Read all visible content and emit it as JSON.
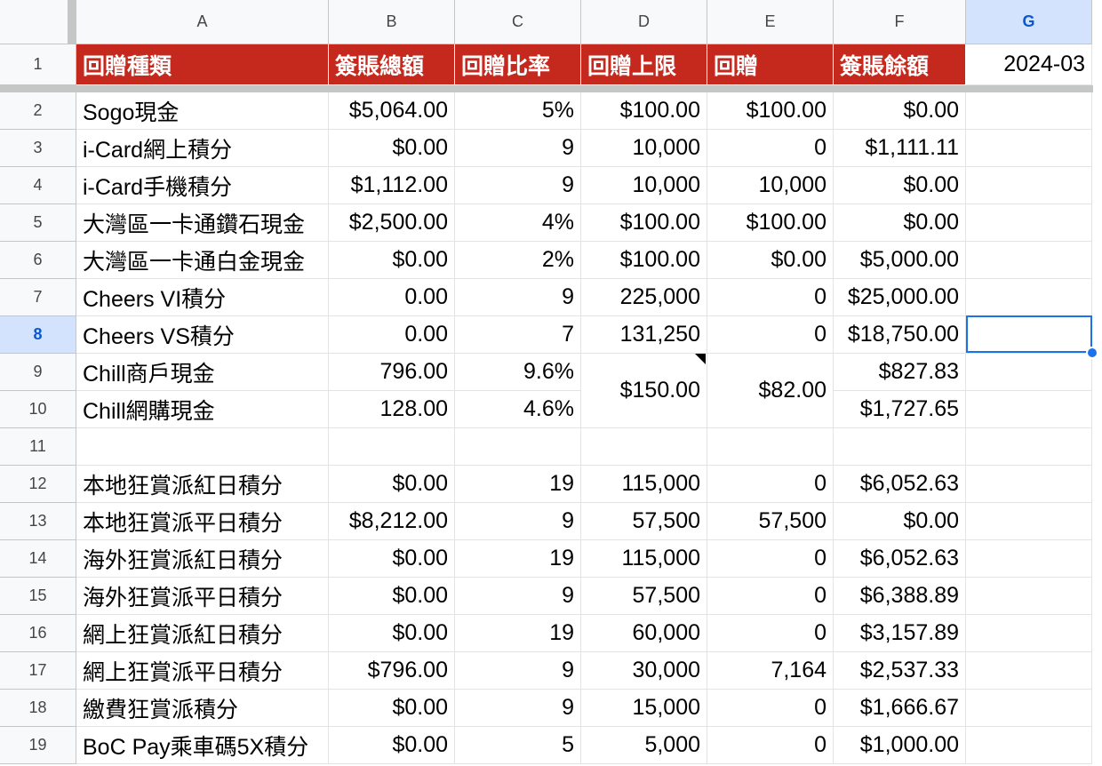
{
  "columns": [
    "A",
    "B",
    "C",
    "D",
    "E",
    "F",
    "G"
  ],
  "selected_column": "G",
  "selected_row": "8",
  "header_row": {
    "row": "1",
    "cells": [
      "回贈種類",
      "簽賬總額",
      "回贈比率",
      "回贈上限",
      "回贈",
      "簽賬餘額"
    ],
    "date": "2024-03"
  },
  "rows": [
    {
      "row": "2",
      "cells": [
        "Sogo現金",
        "$5,064.00",
        "5%",
        "$100.00",
        "$100.00",
        "$0.00",
        ""
      ]
    },
    {
      "row": "3",
      "cells": [
        "i-Card網上積分",
        "$0.00",
        "9",
        "10,000",
        "0",
        "$1,111.11",
        ""
      ]
    },
    {
      "row": "4",
      "cells": [
        "i-Card手機積分",
        "$1,112.00",
        "9",
        "10,000",
        "10,000",
        "$0.00",
        ""
      ]
    },
    {
      "row": "5",
      "cells": [
        "大灣區一卡通鑽石現金",
        "$2,500.00",
        "4%",
        "$100.00",
        "$100.00",
        "$0.00",
        ""
      ]
    },
    {
      "row": "6",
      "cells": [
        "大灣區一卡通白金現金",
        "$0.00",
        "2%",
        "$100.00",
        "$0.00",
        "$5,000.00",
        ""
      ]
    },
    {
      "row": "7",
      "cells": [
        "Cheers VI積分",
        "0.00",
        "9",
        "225,000",
        "0",
        "$25,000.00",
        ""
      ]
    },
    {
      "row": "8",
      "cells": [
        "Cheers VS積分",
        "0.00",
        "7",
        "131,250",
        "0",
        "$18,750.00",
        ""
      ]
    },
    {
      "row": "9",
      "cells": [
        "Chill商戶現金",
        "796.00",
        "9.6%",
        "",
        "",
        "$827.83",
        ""
      ]
    },
    {
      "row": "10",
      "cells": [
        "Chill網購現金",
        "128.00",
        "4.6%",
        "",
        "",
        "$1,727.65",
        ""
      ]
    },
    {
      "row": "11",
      "cells": [
        "",
        "",
        "",
        "",
        "",
        "",
        ""
      ]
    },
    {
      "row": "12",
      "cells": [
        "本地狂賞派紅日積分",
        "$0.00",
        "19",
        "115,000",
        "0",
        "$6,052.63",
        ""
      ]
    },
    {
      "row": "13",
      "cells": [
        "本地狂賞派平日積分",
        "$8,212.00",
        "9",
        "57,500",
        "57,500",
        "$0.00",
        ""
      ]
    },
    {
      "row": "14",
      "cells": [
        "海外狂賞派紅日積分",
        "$0.00",
        "19",
        "115,000",
        "0",
        "$6,052.63",
        ""
      ]
    },
    {
      "row": "15",
      "cells": [
        "海外狂賞派平日積分",
        "$0.00",
        "9",
        "57,500",
        "0",
        "$6,388.89",
        ""
      ]
    },
    {
      "row": "16",
      "cells": [
        "網上狂賞派紅日積分",
        "$0.00",
        "19",
        "60,000",
        "0",
        "$3,157.89",
        ""
      ]
    },
    {
      "row": "17",
      "cells": [
        "網上狂賞派平日積分",
        "$796.00",
        "9",
        "30,000",
        "7,164",
        "$2,537.33",
        ""
      ]
    },
    {
      "row": "18",
      "cells": [
        "繳費狂賞派積分",
        "$0.00",
        "9",
        "15,000",
        "0",
        "$1,666.67",
        ""
      ]
    },
    {
      "row": "19",
      "cells": [
        "BoC Pay乘車碼5X積分",
        "$0.00",
        "5",
        "5,000",
        "0",
        "$1,000.00",
        ""
      ]
    }
  ],
  "merged": {
    "chill_cap": "$150.00",
    "chill_rebate": "$82.00"
  },
  "colors": {
    "header_fill": "#c5281c",
    "header_text": "#ffffff",
    "selection": "#1a73e8"
  }
}
